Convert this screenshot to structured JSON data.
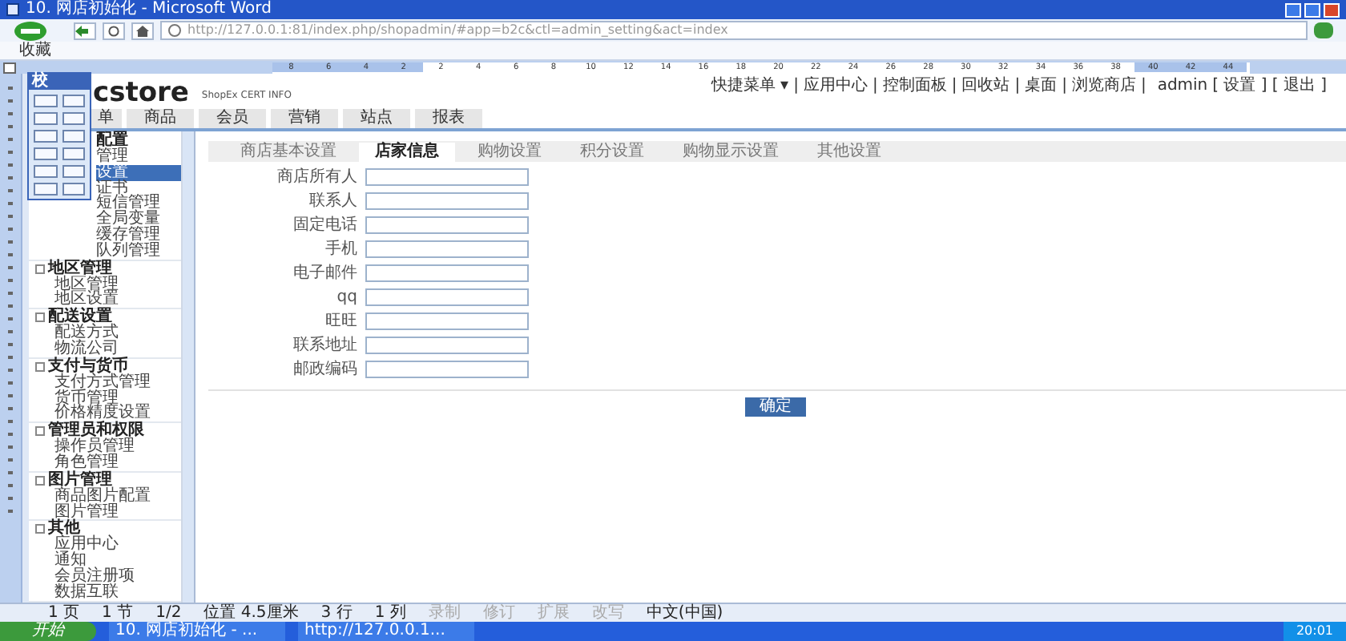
{
  "window": {
    "title": "10. 网店初始化 - Microsoft Word"
  },
  "browser": {
    "url": "http://127.0.0.1:81/index.php/shopadmin/#app=b2c&ctl=admin_setting&act=index",
    "favorites": "收藏"
  },
  "ruler": {
    "marks": [
      "8",
      "6",
      "4",
      "2",
      "2",
      "4",
      "6",
      "8",
      "10",
      "12",
      "14",
      "16",
      "18",
      "20",
      "22",
      "24",
      "26",
      "28",
      "30",
      "32",
      "34",
      "36",
      "38",
      "40",
      "42",
      "44"
    ]
  },
  "floating_toolbar": {
    "title": "校"
  },
  "page": {
    "logo": "cstore",
    "cert": "ShopEx CERT INFO",
    "top_links": [
      "快捷菜单 ▾",
      "应用中心",
      "控制面板",
      "回收站",
      "桌面",
      "浏览商店"
    ],
    "separator": "|",
    "user": "admin",
    "user_links": [
      "[ 设置 ]",
      "[ 退出 ]"
    ],
    "nav": [
      {
        "label": "单",
        "selected": false
      },
      {
        "label": "商品",
        "selected": false
      },
      {
        "label": "会员",
        "selected": false
      },
      {
        "label": "营销",
        "selected": false
      },
      {
        "label": "站点",
        "selected": false
      },
      {
        "label": "报表",
        "selected": false
      }
    ],
    "sidebar": {
      "groups": [
        {
          "title": "配置",
          "items": [
            {
              "label": "管理",
              "selected": false
            },
            {
              "label": "设置",
              "selected": true
            },
            {
              "label": "证书",
              "selected": false
            },
            {
              "label": "短信管理",
              "selected": false
            },
            {
              "label": "全局变量",
              "selected": false
            },
            {
              "label": "缓存管理",
              "selected": false
            },
            {
              "label": "队列管理",
              "selected": false
            }
          ]
        },
        {
          "title": "地区管理",
          "items": [
            {
              "label": "地区管理",
              "selected": false
            },
            {
              "label": "地区设置",
              "selected": false
            }
          ]
        },
        {
          "title": "配送设置",
          "items": [
            {
              "label": "配送方式",
              "selected": false
            },
            {
              "label": "物流公司",
              "selected": false
            }
          ]
        },
        {
          "title": "支付与货币",
          "items": [
            {
              "label": "支付方式管理",
              "selected": false
            },
            {
              "label": "货币管理",
              "selected": false
            },
            {
              "label": "价格精度设置",
              "selected": false
            }
          ]
        },
        {
          "title": "管理员和权限",
          "items": [
            {
              "label": "操作员管理",
              "selected": false
            },
            {
              "label": "角色管理",
              "selected": false
            }
          ]
        },
        {
          "title": "图片管理",
          "items": [
            {
              "label": "商品图片配置",
              "selected": false
            },
            {
              "label": "图片管理",
              "selected": false
            }
          ]
        },
        {
          "title": "其他",
          "items": [
            {
              "label": "应用中心",
              "selected": false
            },
            {
              "label": "通知",
              "selected": false
            },
            {
              "label": "会员注册项",
              "selected": false
            },
            {
              "label": "数据互联",
              "selected": false
            }
          ]
        }
      ]
    },
    "tabs": [
      {
        "label": "商店基本设置",
        "selected": false
      },
      {
        "label": "店家信息",
        "selected": true
      },
      {
        "label": "购物设置",
        "selected": false
      },
      {
        "label": "积分设置",
        "selected": false
      },
      {
        "label": "购物显示设置",
        "selected": false
      },
      {
        "label": "其他设置",
        "selected": false
      }
    ],
    "form": {
      "fields": [
        {
          "label": "商店所有人"
        },
        {
          "label": "联系人"
        },
        {
          "label": "固定电话"
        },
        {
          "label": "手机"
        },
        {
          "label": "电子邮件"
        },
        {
          "label": "qq"
        },
        {
          "label": "旺旺"
        },
        {
          "label": "联系地址"
        },
        {
          "label": "邮政编码"
        }
      ],
      "submit": "确定"
    }
  },
  "status_bar": [
    "1 页",
    "1 节",
    "1/2",
    "位置 4.5厘米",
    "3 行",
    "1 列",
    "录制",
    "修订",
    "扩展",
    "改写",
    "中文(中国)"
  ],
  "taskbar": {
    "start": "开始",
    "tasks": [
      "10. 网店初始化 - ...",
      "http://127.0.0.1..."
    ],
    "clock": "20:01"
  }
}
